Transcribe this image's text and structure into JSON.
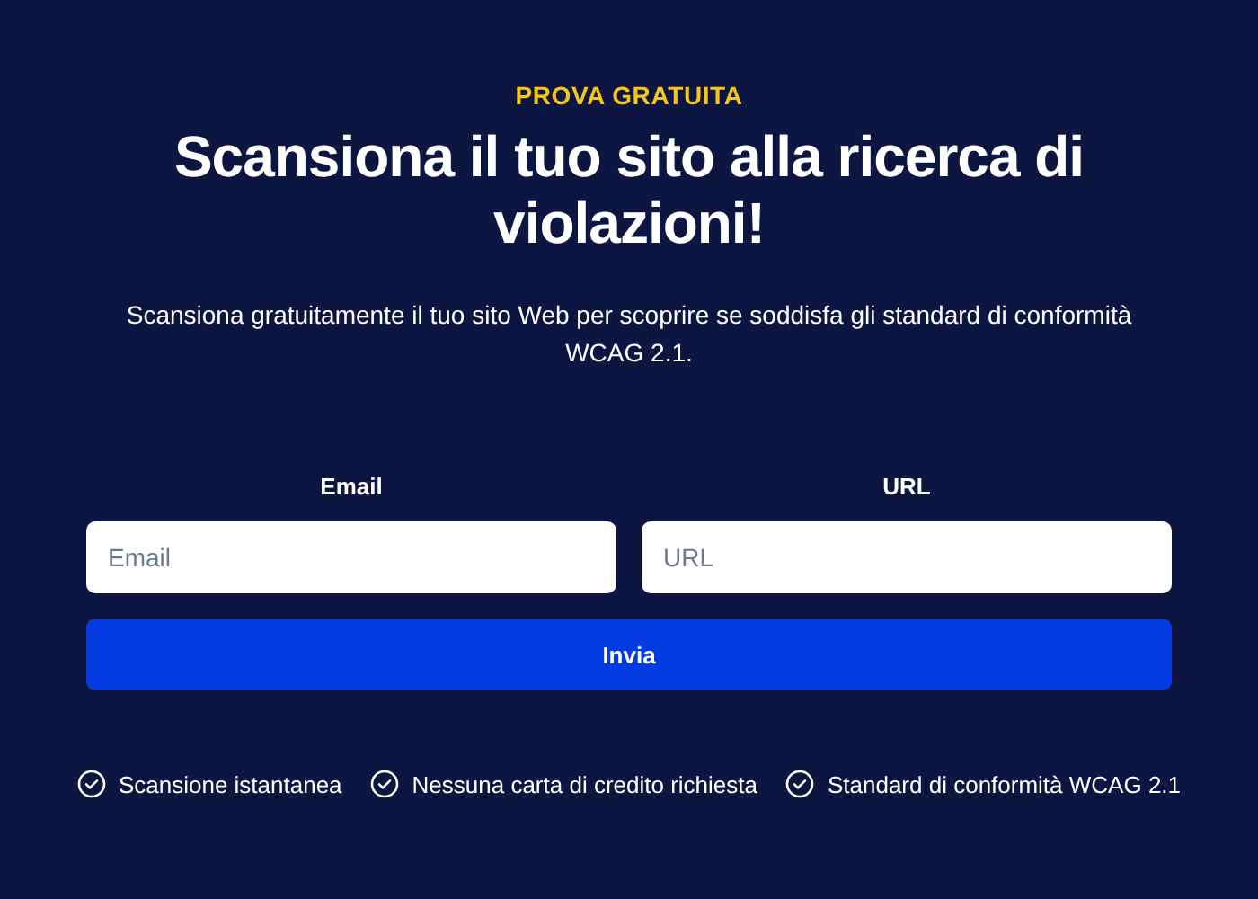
{
  "eyebrow": "PROVA GRATUITA",
  "heading": "Scansiona il tuo sito alla ricerca di violazioni!",
  "description": "Scansiona gratuitamente il tuo sito Web per scoprire se soddisfa gli standard di conformità WCAG 2.1.",
  "fields": [
    {
      "label": "Email",
      "placeholder": "Email"
    },
    {
      "label": "URL",
      "placeholder": "URL"
    }
  ],
  "submit_button": "Invia",
  "features": [
    "Scansione istantanea",
    "Nessuna carta di credito richiesta",
    "Standard di conformità WCAG 2.1"
  ]
}
